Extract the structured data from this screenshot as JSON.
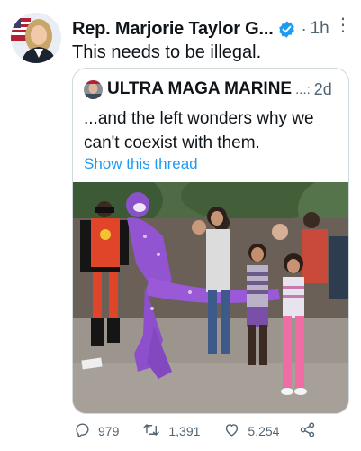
{
  "tweet": {
    "author_name": "Rep. Marjorie Taylor G...",
    "verified_icon": "verified-badge-icon",
    "separator": "·",
    "time": "1h",
    "more_icon": "more-options-icon",
    "text": "This needs to be illegal."
  },
  "quote": {
    "author_name": "ULTRA MAGA MARINE",
    "ellipsis": "...:",
    "time": "2d",
    "text": "...and the left wonders why we can't coexist with them.",
    "show_thread": "Show this thread",
    "photo": "street-photo-costumed-performer-with-child"
  },
  "actions": {
    "replies": "979",
    "retweets": "1,391",
    "likes": "5,254",
    "reply_icon": "reply-icon",
    "retweet_icon": "retweet-icon",
    "like_icon": "heart-icon",
    "share_icon": "share-icon"
  },
  "colors": {
    "link": "#1d9bf0",
    "secondary_text": "#536471",
    "border": "#cfd9de"
  }
}
